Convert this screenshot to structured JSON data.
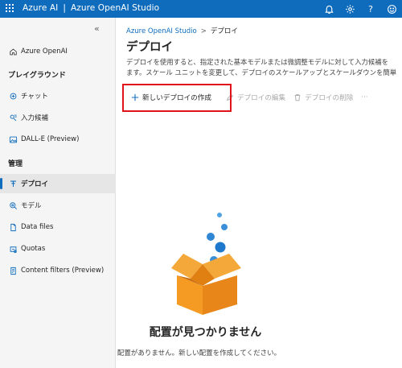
{
  "topbar": {
    "brand": "Azure AI",
    "separator": "|",
    "product": "Azure OpenAI Studio",
    "icons": [
      "waffle-icon",
      "bell-icon",
      "gear-icon",
      "help-icon",
      "smiley-icon"
    ],
    "help_glyph": "?"
  },
  "sidebar": {
    "collapse_glyph": "«",
    "home": "Azure OpenAI",
    "section_playground": "プレイグラウンド",
    "chat": "チャット",
    "completions": "入力候補",
    "dalle": "DALL-E (Preview)",
    "section_manage": "管理",
    "deployments": "デプロイ",
    "models": "モデル",
    "data_files": "Data files",
    "quotas": "Quotas",
    "content_filters": "Content filters (Preview)"
  },
  "breadcrumb": {
    "root": "Azure OpenAI Studio",
    "chevron": ">",
    "current": "デプロイ"
  },
  "page": {
    "title": "デプロイ",
    "description_line1": "デプロイを使用すると、指定された基本モデルまたは微調整モデルに対して入力候補を",
    "description_line2": "ます。スケール ユニットを変更して、デプロイのスケールアップとスケールダウンを簡単"
  },
  "toolbar": {
    "create_label": "新しいデプロイの作成",
    "edit_label": "デプロイの編集",
    "delete_label": "デプロイの削除",
    "more_label": "···"
  },
  "empty_state": {
    "title": "配置が見つかりません",
    "message": "配置がありません。新しい配置を作成してください。"
  },
  "colors": {
    "accent": "#0f6cbd",
    "highlight": "#e0121a",
    "box_orange": "#f59a23"
  }
}
